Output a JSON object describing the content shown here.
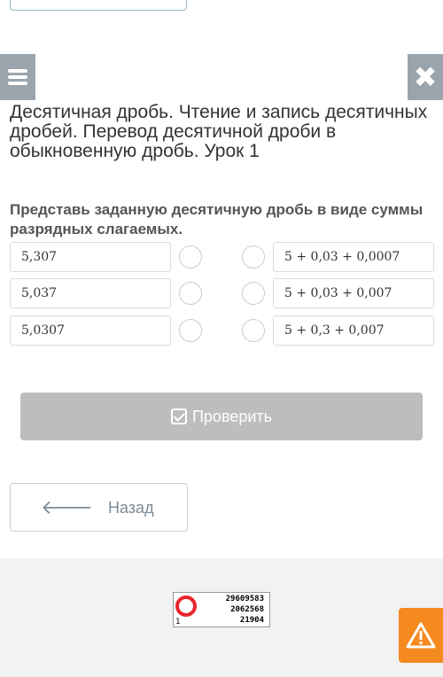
{
  "header": {
    "lesson_title": "Десятичная дробь. Чтение и запись десятичных дробей. Перевод десятичной дроби в обыкновенную дробь. Урок 1"
  },
  "task": {
    "prompt": "Представь заданную десятичную дробь в виде суммы разрядных слагаемых.",
    "left_items": [
      "5,307",
      "5,037",
      "5,0307"
    ],
    "right_items": [
      "5 + 0,03 + 0,0007",
      "5 + 0,03 + 0,007",
      "5 + 0,3 + 0,007"
    ]
  },
  "actions": {
    "check_label": "Проверить",
    "back_label": "Назад"
  },
  "counter": {
    "lines": [
      "29609583",
      "2062568",
      "21904"
    ],
    "one": "1"
  },
  "icons": {
    "menu": "menu-icon",
    "close": "close-icon",
    "check": "check-icon",
    "back": "arrow-left-icon",
    "warning": "warning-icon"
  },
  "colors": {
    "side_buttons": "#9aa4ad",
    "check_button": "#bdbdbd",
    "warning": "#f58a1f",
    "counter_ring": "#e8242c"
  }
}
